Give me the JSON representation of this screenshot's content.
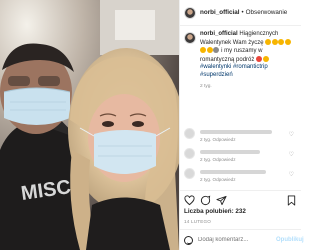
{
  "post": {
    "username": "norbi_official",
    "follow_label": "Obserwowanie",
    "caption": {
      "username": "norbi_official",
      "text_1": "Hiągiencznych Walentynek Wam życzę",
      "text_2": "i my ruszamy w romantyczną podróż",
      "hashtags": [
        "#walentynki",
        "#romantictrip",
        "#superdzień"
      ],
      "time": "2 tyg."
    },
    "comments": [
      {
        "meta": "2 tyg.   Odpowiedz"
      },
      {
        "meta": "2 tyg.   Odpowiedz"
      },
      {
        "meta": "2 tyg.   Odpowiedz"
      }
    ],
    "likes_label": "Liczba polubień: 232",
    "date": "14 LUTEGO",
    "add_comment_placeholder": "Dodaj komentarz...",
    "post_button": "Opublikuj",
    "photo": {
      "shirt_text": "MISC"
    }
  }
}
